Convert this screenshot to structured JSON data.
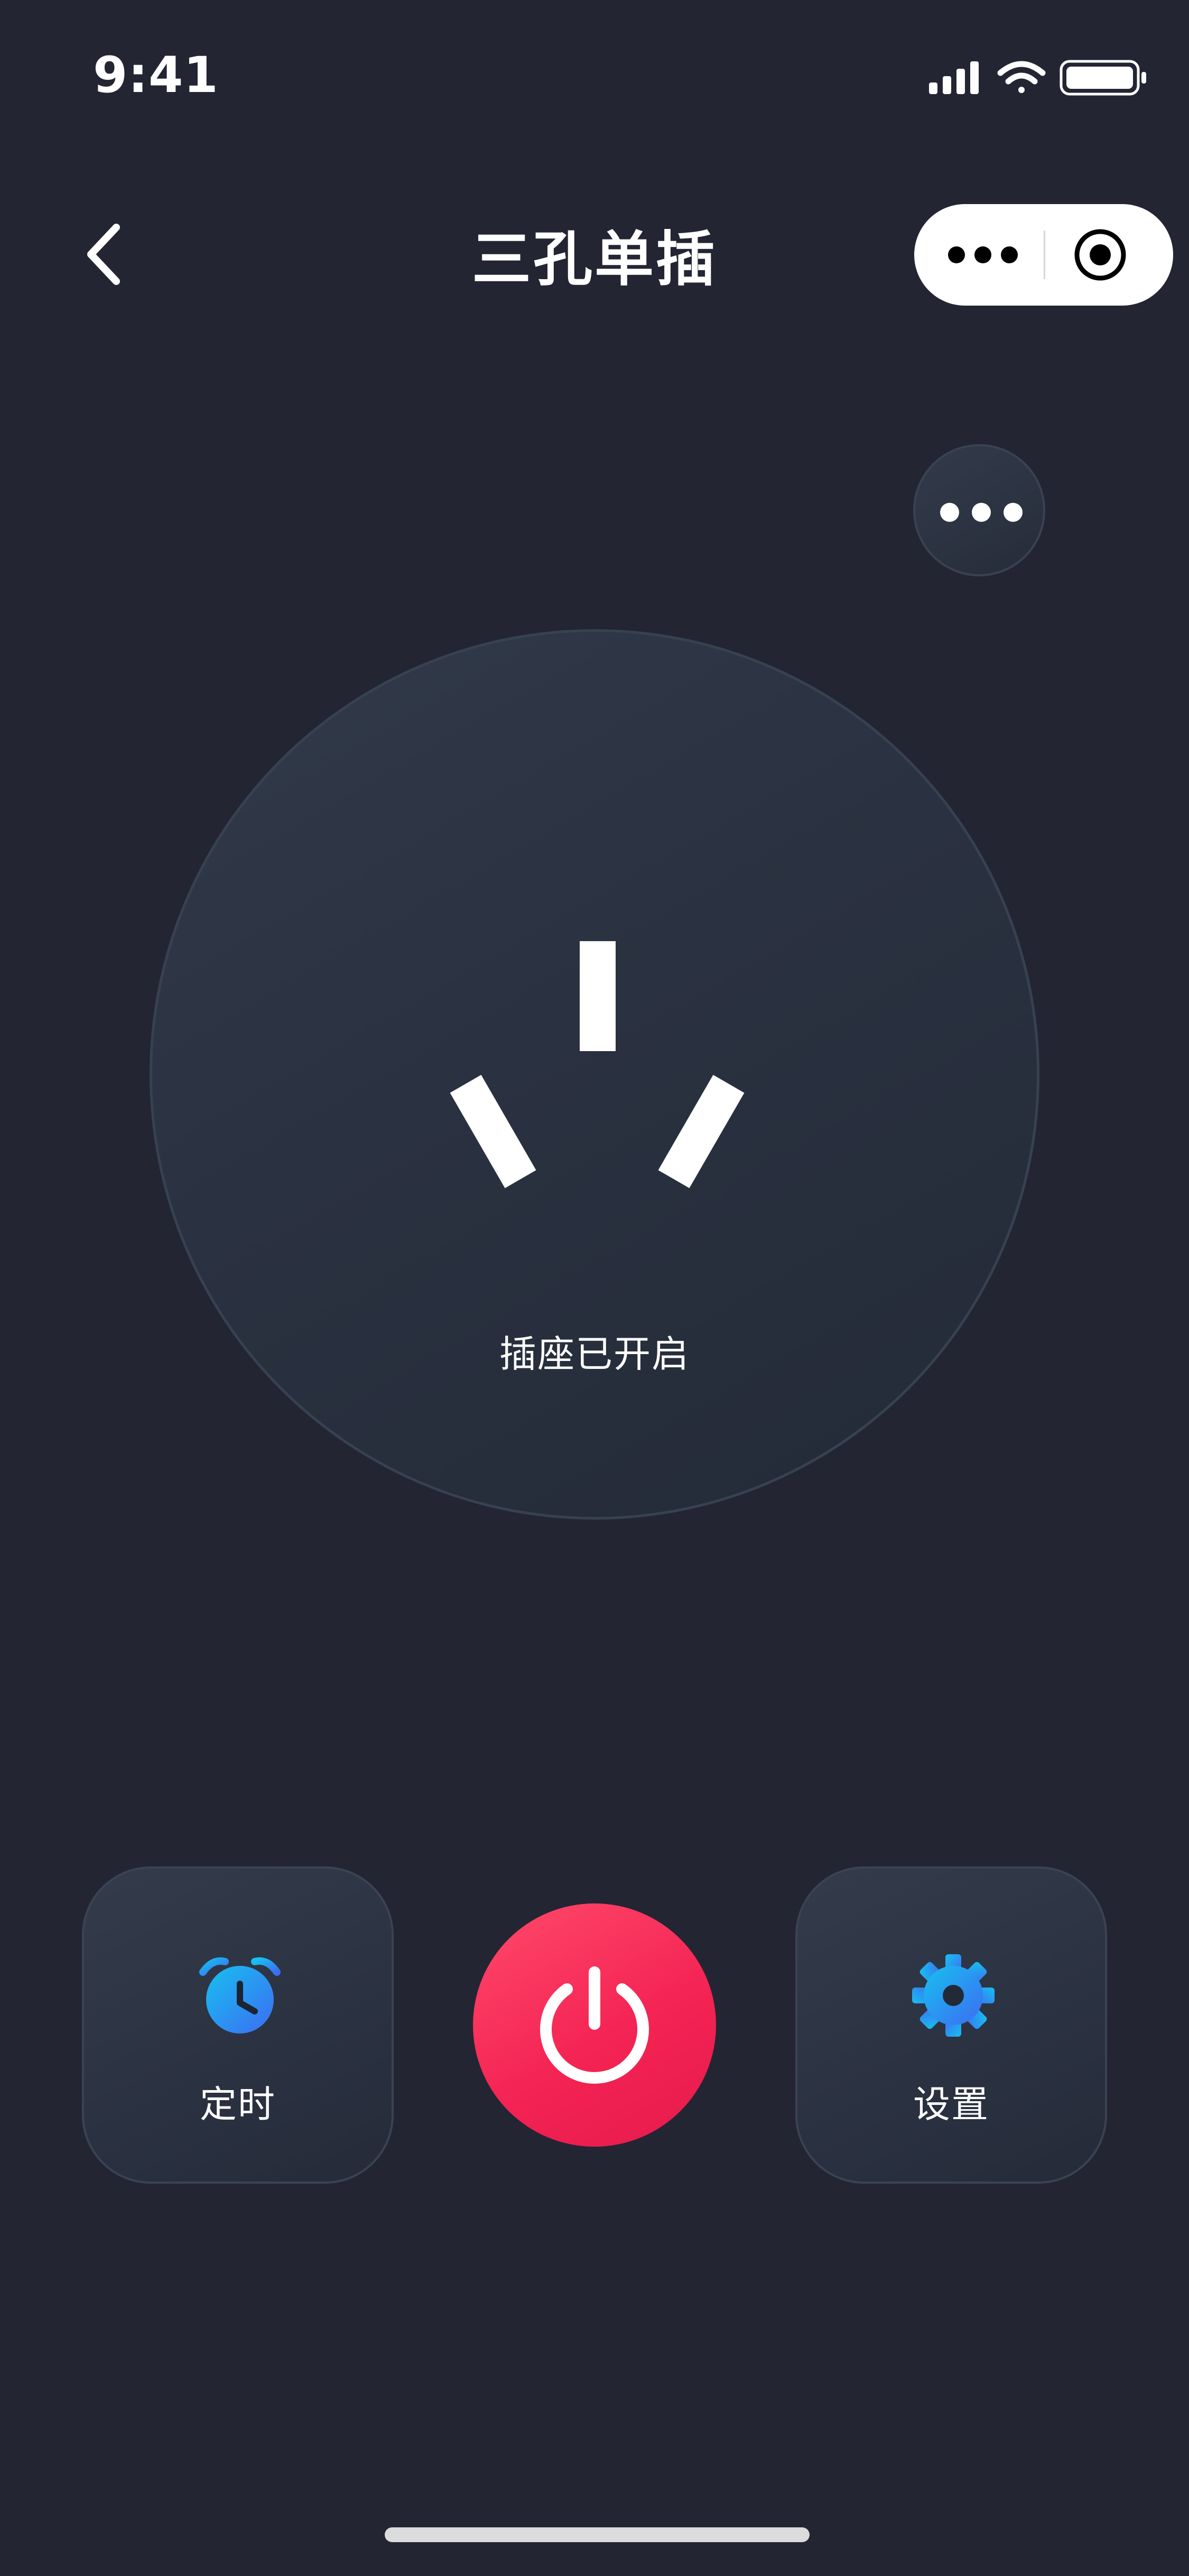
{
  "status_bar": {
    "time": "9:41"
  },
  "header": {
    "title": "三孔单插"
  },
  "socket": {
    "status": "插座已开启"
  },
  "controls": {
    "timer_label": "定时",
    "settings_label": "设置"
  },
  "colors": {
    "background": "#232533",
    "power_button": "#f42454",
    "accent_blue": "#2f8cff"
  },
  "icons": {
    "back": "chevron-left-icon",
    "capsule_more": "more-dots-icon",
    "capsule_close": "target-icon",
    "socket_more": "more-dots-icon",
    "timer": "alarm-clock-icon",
    "power": "power-icon",
    "settings": "gear-icon"
  }
}
